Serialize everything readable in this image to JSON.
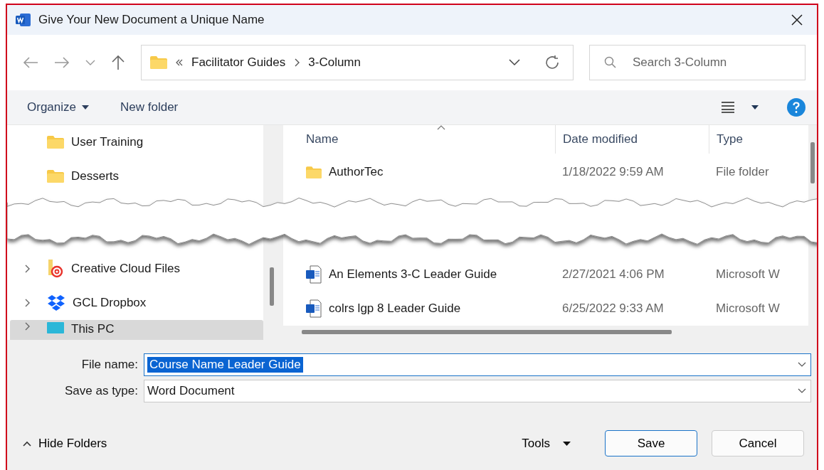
{
  "window": {
    "title": "Give Your New Document a Unique Name"
  },
  "nav": {
    "path": [
      "Facilitator Guides",
      "3-Column"
    ],
    "search": {
      "placeholder": "Search 3-Column"
    }
  },
  "toolbar": {
    "organize": "Organize",
    "new_folder": "New folder"
  },
  "sidebar": {
    "top_items": [
      {
        "label": "User Training",
        "kind": "folder",
        "expandable": false,
        "selected": false
      },
      {
        "label": "Desserts",
        "kind": "folder",
        "expandable": false,
        "selected": false
      }
    ],
    "bottom_items": [
      {
        "label": "Creative Cloud Files",
        "kind": "cloud-folder",
        "expandable": true,
        "selected": false
      },
      {
        "label": "GCL Dropbox",
        "kind": "dropbox",
        "expandable": true,
        "selected": false
      },
      {
        "label": "This PC",
        "kind": "pc",
        "expandable": true,
        "selected": true
      }
    ]
  },
  "files": {
    "columns": [
      "Name",
      "Date modified",
      "Type"
    ],
    "top_rows": [
      {
        "name": "AuthorTec",
        "kind": "folder",
        "date": "1/18/2022 9:59 AM",
        "type": "File folder"
      }
    ],
    "bottom_rows": [
      {
        "name": "An Elements 3-C Leader Guide",
        "kind": "word",
        "date": "2/27/2021 4:06 PM",
        "type": "Microsoft W"
      },
      {
        "name": "colrs lgp 8 Leader Guide",
        "kind": "word",
        "date": "6/25/2022 9:33 AM",
        "type": "Microsoft W"
      }
    ]
  },
  "file_name": {
    "label": "File name:",
    "value": "Course Name Leader Guide"
  },
  "save_type": {
    "label": "Save as type:",
    "value": "Word Document"
  },
  "footer": {
    "hide_folders": "Hide Folders",
    "tools": "Tools",
    "buttons": [
      {
        "label": "Save",
        "kind": "primary"
      },
      {
        "label": "Cancel",
        "kind": "secondary"
      }
    ]
  }
}
